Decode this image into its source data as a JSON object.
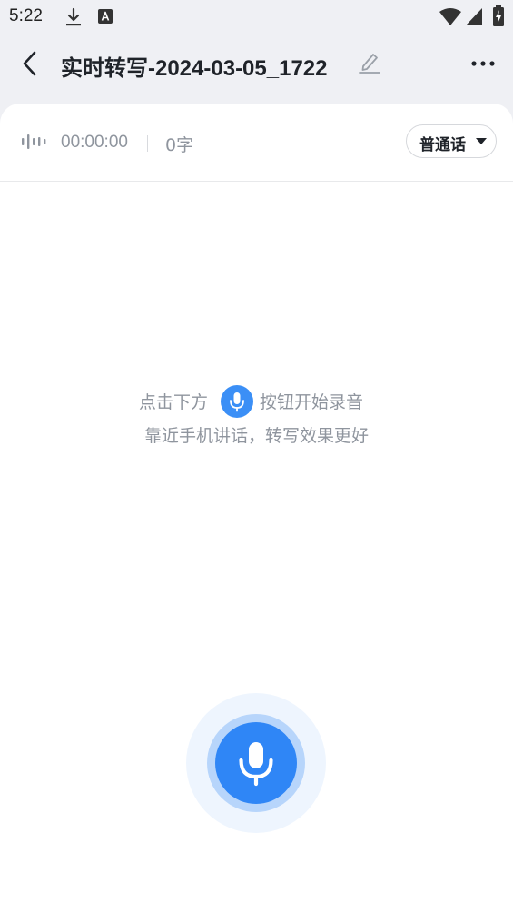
{
  "status_bar": {
    "time": "5:22",
    "icons": [
      "download-icon",
      "keyboard-a-icon",
      "wifi-icon",
      "signal-icon",
      "battery-charging-icon"
    ]
  },
  "header": {
    "title": "实时转写-2024-03-05_1722",
    "back_icon": "chevron-left-icon",
    "edit_icon": "pencil-icon",
    "more_icon": "more-horizontal-icon"
  },
  "info_bar": {
    "duration": "00:00:00",
    "word_count": "0字",
    "language": "普通话"
  },
  "hint": {
    "line1_before": "点击下方",
    "line1_after": "按钮开始录音",
    "line2": "靠近手机讲话，转写效果更好"
  },
  "colors": {
    "accent": "#2f86f6",
    "hint_text": "#8f959e",
    "background": "#eff0f4"
  }
}
